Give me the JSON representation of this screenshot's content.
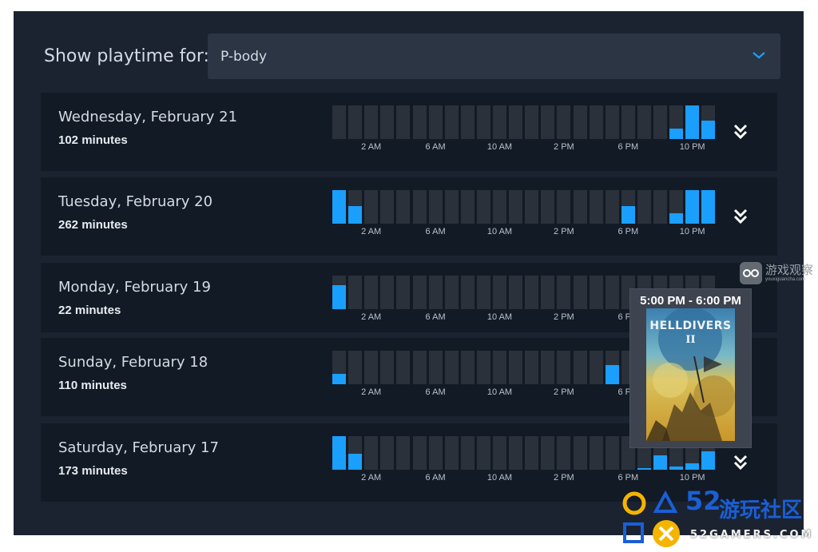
{
  "filter": {
    "label": "Show playtime for:",
    "selected": "P-body"
  },
  "tick_labels": [
    "2 AM",
    "6 AM",
    "10 AM",
    "2 PM",
    "6 PM",
    "10 PM"
  ],
  "accent_color": "#1a9fff",
  "days": [
    {
      "name": "Wednesday, February 21",
      "minutes": "102 minutes",
      "hourly_fraction": [
        0,
        0,
        0,
        0,
        0,
        0,
        0,
        0,
        0,
        0,
        0,
        0,
        0,
        0,
        0,
        0,
        0,
        0,
        0,
        0,
        0,
        0.3,
        1.0,
        0.55
      ]
    },
    {
      "name": "Tuesday, February 20",
      "minutes": "262 minutes",
      "hourly_fraction": [
        1.0,
        0.52,
        0,
        0,
        0,
        0,
        0,
        0,
        0,
        0,
        0,
        0,
        0,
        0,
        0,
        0,
        0,
        0,
        0.52,
        0,
        0,
        0.32,
        1.0,
        1.0
      ]
    },
    {
      "name": "Monday, February 19",
      "minutes": "22 minutes",
      "hourly_fraction": [
        0.72,
        0,
        0,
        0,
        0,
        0,
        0,
        0,
        0,
        0,
        0,
        0,
        0,
        0,
        0,
        0,
        0,
        0,
        0,
        0,
        0,
        0,
        0,
        0
      ]
    },
    {
      "name": "Sunday, February 18",
      "minutes": "110 minutes",
      "hourly_fraction": [
        0.32,
        0,
        0,
        0,
        0,
        0,
        0,
        0,
        0,
        0,
        0,
        0,
        0,
        0,
        0,
        0,
        0,
        0.58,
        0,
        0,
        0,
        0,
        0,
        0
      ]
    },
    {
      "name": "Saturday, February 17",
      "minutes": "173 minutes",
      "hourly_fraction": [
        1.0,
        0.48,
        0,
        0,
        0,
        0,
        0,
        0,
        0,
        0,
        0,
        0,
        0,
        0,
        0,
        0,
        0,
        0,
        0,
        0.05,
        0.42,
        0.1,
        0.2,
        0.55
      ]
    }
  ],
  "tooltip": {
    "time_range": "5:00 PM - 6:00 PM",
    "game_logo": "HELLDIVERS",
    "game_numeral": "II"
  },
  "watermarks": {
    "top_cn": "游戏观察",
    "top_en": "youxiguancha.com",
    "bottom_cn": "游玩社区",
    "bottom_num": "52",
    "bottom_en": "52GAMERS.COM"
  },
  "icons": {
    "dropdown": "chevron-down-icon",
    "expand": "double-chevron-down-icon"
  }
}
